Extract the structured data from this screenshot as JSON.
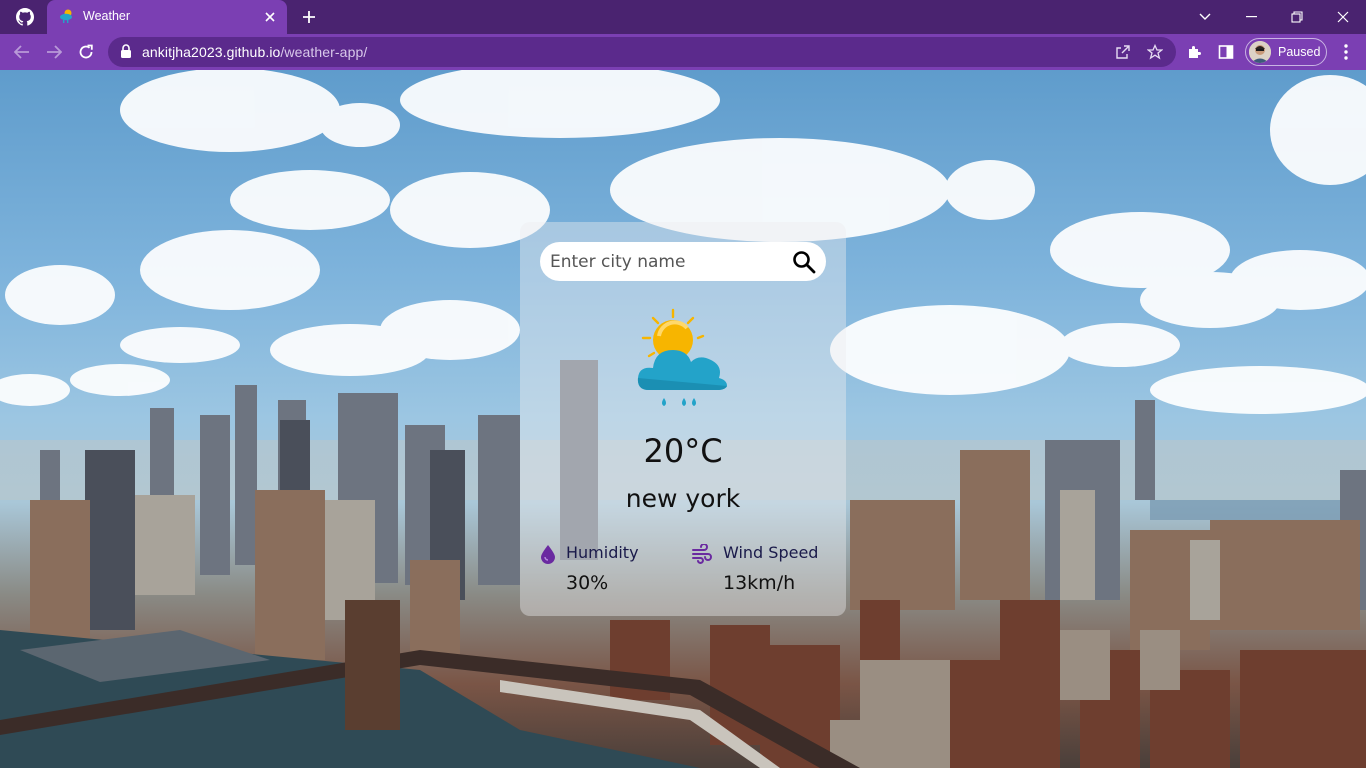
{
  "browser": {
    "tab_title": "Weather",
    "url_host": "ankitjha2023.github.io",
    "url_path": "/weather-app/",
    "profile_status": "Paused",
    "icons": [
      "github-icon",
      "close-icon",
      "plus-icon",
      "chevron-down-icon",
      "minimize-icon",
      "restore-icon",
      "close-window-icon",
      "back-icon",
      "forward-icon",
      "reload-icon",
      "lock-icon",
      "share-icon",
      "star-icon",
      "puzzle-icon",
      "sidepanel-icon",
      "more-icon"
    ]
  },
  "app": {
    "search_placeholder": "Enter city name",
    "temperature": "20°C",
    "city": "new york",
    "humidity_label": "Humidity",
    "humidity_value": "30%",
    "wind_label": "Wind Speed",
    "wind_value": "13km/h",
    "weather_condition": "sun-cloud-rain-icon"
  },
  "colors": {
    "chrome_dark": "#4a2370",
    "chrome_accent": "#7b3fb3",
    "detail_icon": "#6a2aa0"
  }
}
